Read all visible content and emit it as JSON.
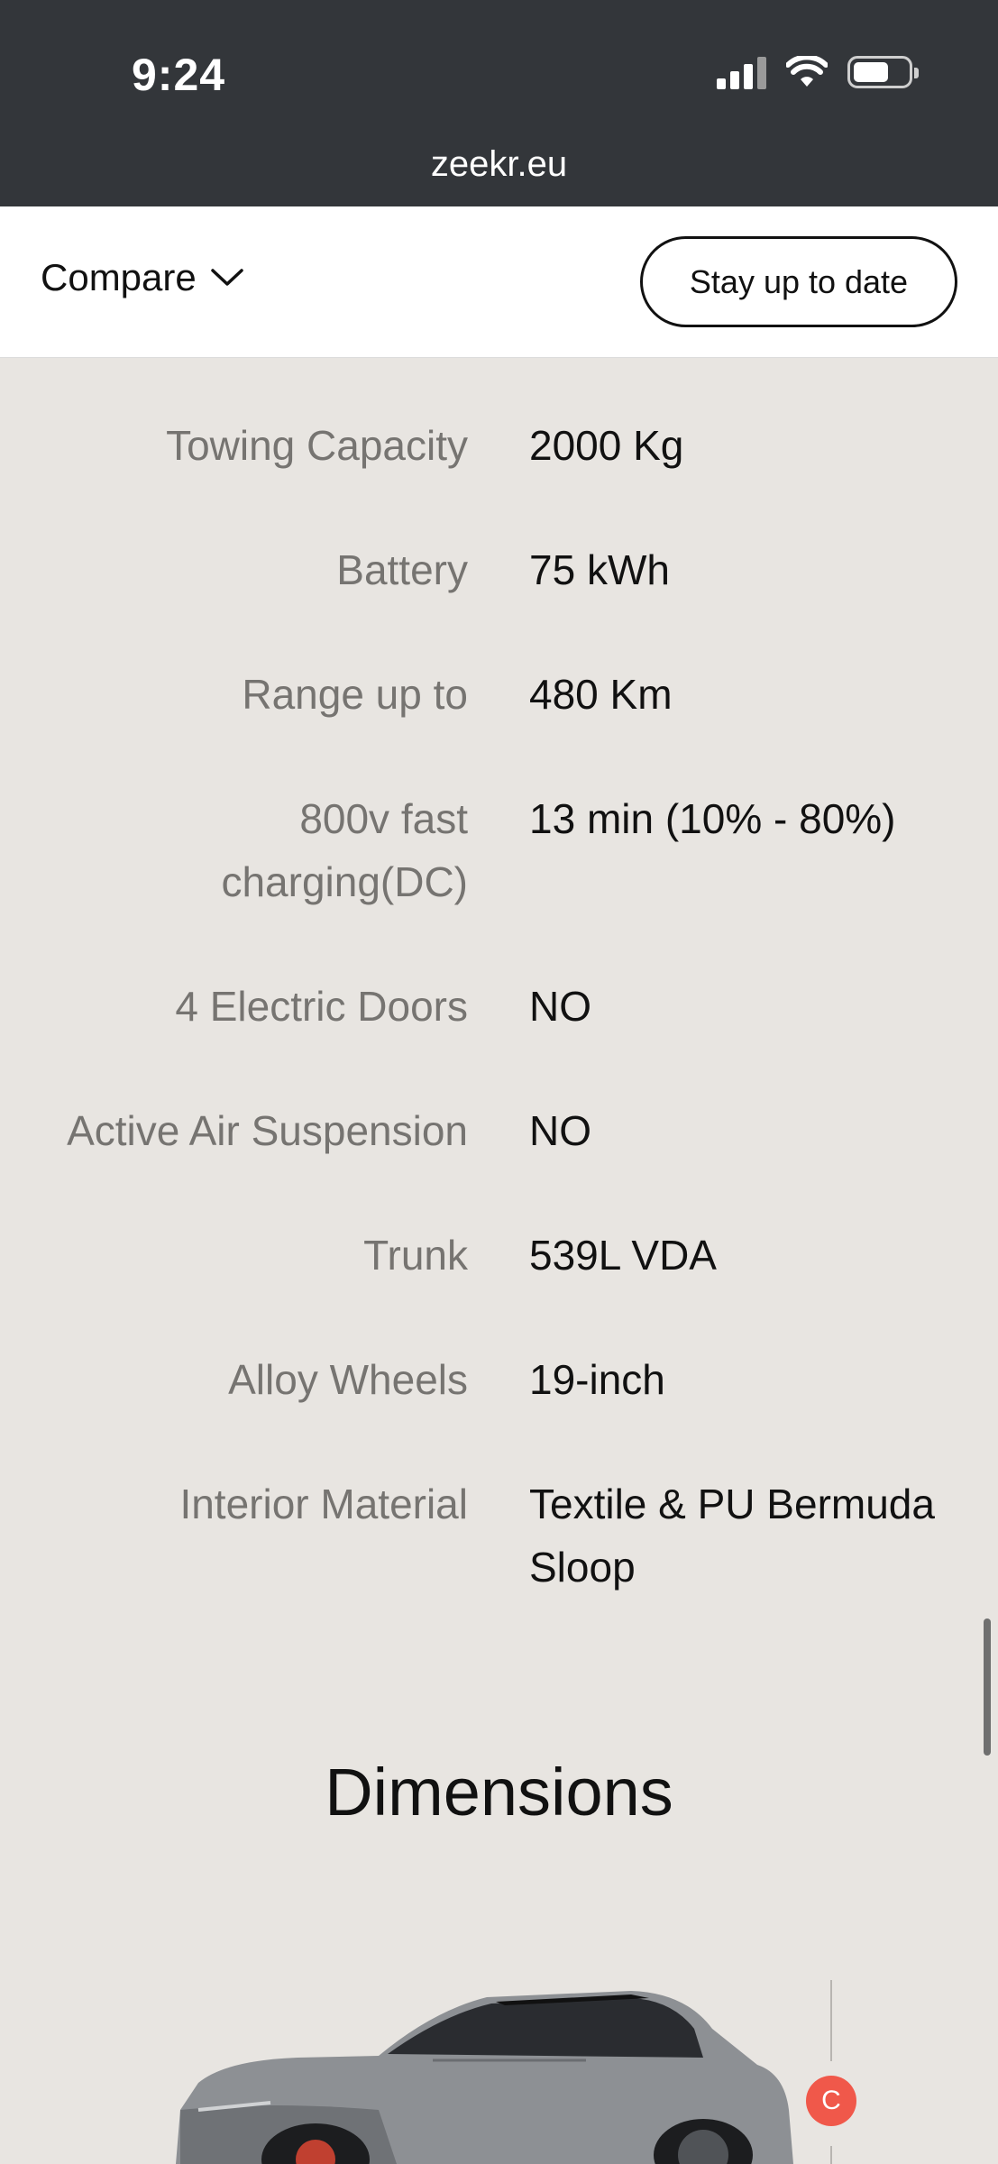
{
  "status_bar": {
    "time": "9:24",
    "icons": [
      "signal-icon",
      "wifi-icon",
      "battery-icon"
    ]
  },
  "browser": {
    "url": "zeekr.eu"
  },
  "header": {
    "compare_label": "Compare",
    "stay_button": "Stay up to date"
  },
  "specs": [
    {
      "label": "Towing Capacity",
      "value": "2000 Kg"
    },
    {
      "label": "Battery",
      "value": "75 kWh"
    },
    {
      "label": "Range up to",
      "value": "480 Km"
    },
    {
      "label": "800v fast charging(DC)",
      "value": "13 min (10% - 80%)"
    },
    {
      "label": "4 Electric Doors",
      "value": "NO"
    },
    {
      "label": "Active Air Suspension",
      "value": "NO"
    },
    {
      "label": "Trunk",
      "value": "539L VDA"
    },
    {
      "label": "Alloy Wheels",
      "value": "19-inch"
    },
    {
      "label": "Interior Material",
      "value": "Textile & PU Bermuda Sloop"
    }
  ],
  "dimensions": {
    "title": "Dimensions",
    "badge": "C"
  },
  "colors": {
    "page_bg": "#e8e5e1",
    "status_bg": "#33363a",
    "badge": "#f0584a"
  }
}
